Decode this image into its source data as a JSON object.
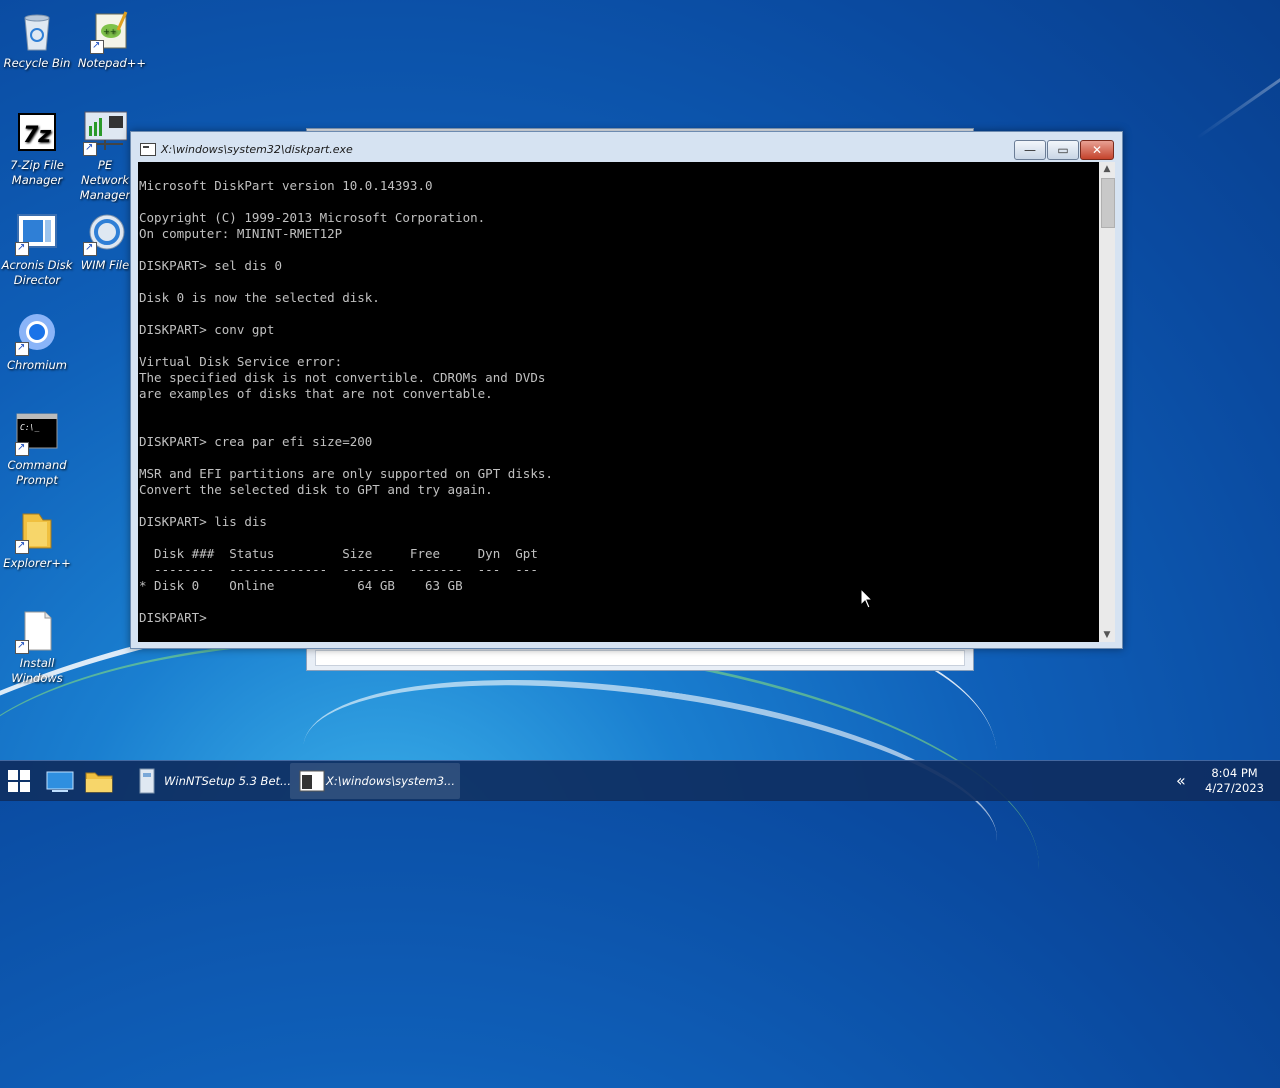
{
  "desktop": {
    "icons": [
      {
        "label": "Recycle Bin",
        "icon": "recycle-bin-icon"
      },
      {
        "label": "Notepad++",
        "icon": "notepad-plus-plus-icon"
      },
      {
        "label": "7-Zip File Manager",
        "icon": "seven-zip-icon"
      },
      {
        "label": "PE Network Manager",
        "icon": "network-manager-icon"
      },
      {
        "label": "Acronis Disk Director",
        "icon": "acronis-icon"
      },
      {
        "label": "WIM File",
        "icon": "wim-file-icon"
      },
      {
        "label": "Chromium",
        "icon": "chromium-icon"
      },
      {
        "label": "Command Prompt",
        "icon": "command-prompt-icon"
      },
      {
        "label": "Explorer++",
        "icon": "explorer-plus-plus-icon"
      },
      {
        "label": "Install Windows",
        "icon": "install-windows-icon"
      }
    ]
  },
  "console_window": {
    "title": "X:\\windows\\system32\\diskpart.exe",
    "buttons": {
      "minimize": "—",
      "maximize": "▭",
      "close": "✕"
    },
    "lines": [
      "Microsoft DiskPart version 10.0.14393.0",
      "",
      "Copyright (C) 1999-2013 Microsoft Corporation.",
      "On computer: MININT-RMET12P",
      "",
      "DISKPART> sel dis 0",
      "",
      "Disk 0 is now the selected disk.",
      "",
      "DISKPART> conv gpt",
      "",
      "Virtual Disk Service error:",
      "The specified disk is not convertible. CDROMs and DVDs",
      "are examples of disks that are not convertable.",
      "",
      "",
      "DISKPART> crea par efi size=200",
      "",
      "MSR and EFI partitions are only supported on GPT disks.",
      "Convert the selected disk to GPT and try again.",
      "",
      "DISKPART> lis dis",
      "",
      "  Disk ###  Status         Size     Free     Dyn  Gpt",
      "  --------  -------------  -------  -------  ---  ---",
      "* Disk 0    Online           64 GB    63 GB",
      "",
      "DISKPART> "
    ]
  },
  "taskbar": {
    "tasks": [
      {
        "label": "WinNTSetup 5.3 Bet...",
        "icon": "winntsetup-icon"
      },
      {
        "label": "X:\\windows\\system3...",
        "icon": "console-icon"
      }
    ],
    "tray_chevron": "«",
    "clock": {
      "time": "8:04 PM",
      "date": "4/27/2023"
    }
  },
  "colors": {
    "console_bg": "#000000",
    "console_fg": "#c0c0c0",
    "taskbar": "#0e2c60",
    "desktop": "#0f5fb8"
  }
}
